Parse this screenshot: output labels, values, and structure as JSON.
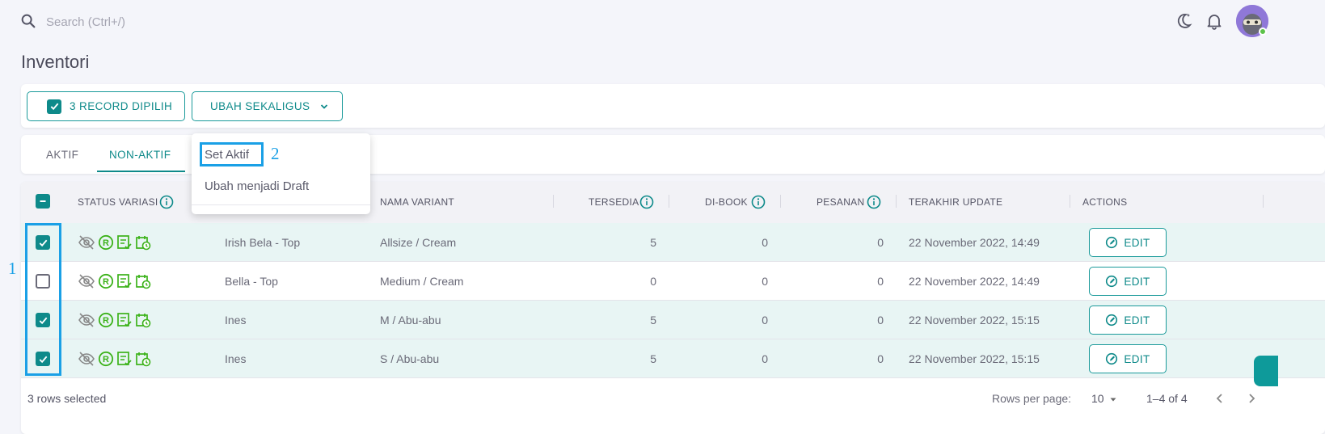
{
  "topbar": {
    "search_placeholder": "Search (Ctrl+/)",
    "icons": [
      "search-icon",
      "theme-toggle-icon",
      "bell-icon",
      "avatar"
    ]
  },
  "page": {
    "title": "Inventori"
  },
  "actions": {
    "selected_label": "3 RECORD DIPILIH",
    "bulk_label": "UBAH SEKALIGUS"
  },
  "tabs": [
    {
      "label": "AKTIF",
      "active": false
    },
    {
      "label": "NON-AKTIF",
      "active": true
    }
  ],
  "dropdown": {
    "items": [
      "Set Aktif",
      "Ubah menjadi Draft"
    ]
  },
  "table": {
    "headers": {
      "status": "STATUS VARIASI",
      "variant": "NAMA VARIANT",
      "available": "TERSEDIA",
      "booked": "DI-BOOK",
      "orders": "PESANAN",
      "updated": "TERAKHIR UPDATE",
      "actions": "ACTIONS"
    },
    "edit_label": "EDIT",
    "rows": [
      {
        "selected": true,
        "product": "Irish Bela - Top",
        "variant": "Allsize / Cream",
        "available": "5",
        "booked": "0",
        "orders": "0",
        "updated": "22 November 2022, 14:49"
      },
      {
        "selected": false,
        "product": "Bella - Top",
        "variant": "Medium / Cream",
        "available": "0",
        "booked": "0",
        "orders": "0",
        "updated": "22 November 2022, 14:49"
      },
      {
        "selected": true,
        "product": "Ines",
        "variant": "M / Abu-abu",
        "available": "5",
        "booked": "0",
        "orders": "0",
        "updated": "22 November 2022, 15:15"
      },
      {
        "selected": true,
        "product": "Ines",
        "variant": "S / Abu-abu",
        "available": "5",
        "booked": "0",
        "orders": "0",
        "updated": "22 November 2022, 15:15"
      }
    ]
  },
  "footer": {
    "selected_text": "3 rows selected",
    "rows_per_page_label": "Rows per page:",
    "rows_per_page_value": "10",
    "range": "1–4 of 4"
  },
  "annotations": {
    "label_1": "1",
    "label_2": "2"
  },
  "colors": {
    "accent": "#0e8a8a",
    "annotation": "#1aa0e6",
    "status_icon": "#3cb21a"
  }
}
